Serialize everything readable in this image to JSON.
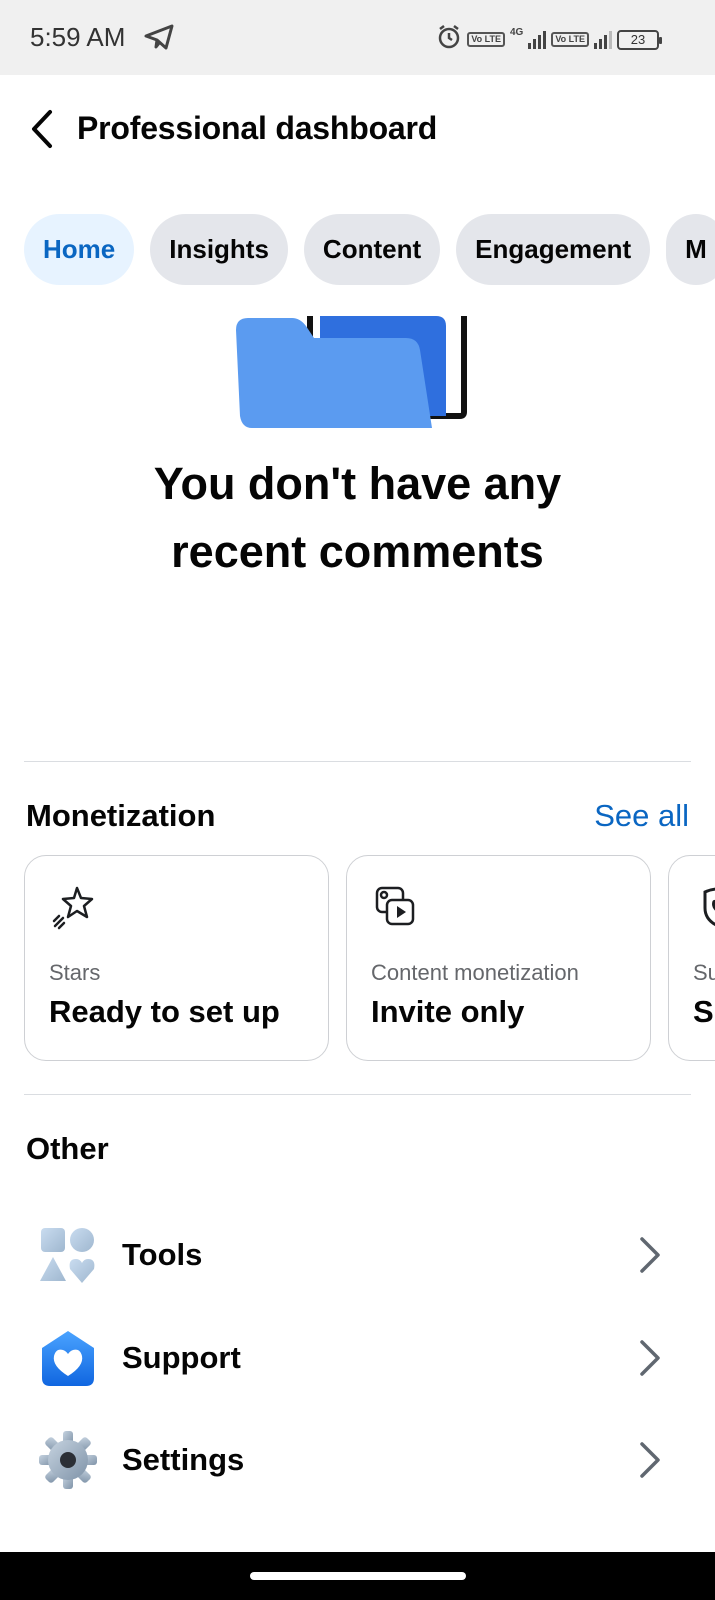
{
  "status_bar": {
    "time": "5:59 AM",
    "volte1": "Vo LTE",
    "network": "4G",
    "volte2": "Vo LTE",
    "battery": "23",
    "icons": [
      "telegram-icon",
      "alarm-icon",
      "signal-icon",
      "battery-icon"
    ]
  },
  "header": {
    "title": "Professional dashboard",
    "back_icon": "back-arrow-icon"
  },
  "tabs": [
    {
      "label": "Home",
      "active": true
    },
    {
      "label": "Insights",
      "active": false
    },
    {
      "label": "Content",
      "active": false
    },
    {
      "label": "Engagement",
      "active": false
    },
    {
      "label": "M",
      "active": false
    }
  ],
  "empty_state": {
    "line1": "You don't have any",
    "line2": "recent comments",
    "illustration": "folder-illustration"
  },
  "monetization": {
    "title": "Monetization",
    "see_all": "See all",
    "cards": [
      {
        "icon": "stars-icon",
        "label": "Stars",
        "value": "Ready to set up"
      },
      {
        "icon": "content-monetization-icon",
        "label": "Content monetization",
        "value": "Invite only"
      },
      {
        "icon": "subscriptions-icon",
        "label": "Su",
        "value": "S"
      }
    ]
  },
  "other": {
    "title": "Other",
    "items": [
      {
        "icon": "tools-icon",
        "label": "Tools"
      },
      {
        "icon": "support-icon",
        "label": "Support"
      },
      {
        "icon": "settings-icon",
        "label": "Settings"
      }
    ]
  },
  "colors": {
    "accent": "#0a66c2",
    "active_tab_bg": "#e7f3ff",
    "tab_bg": "#e4e6eb",
    "folder_blue": "#5b9bf0"
  }
}
